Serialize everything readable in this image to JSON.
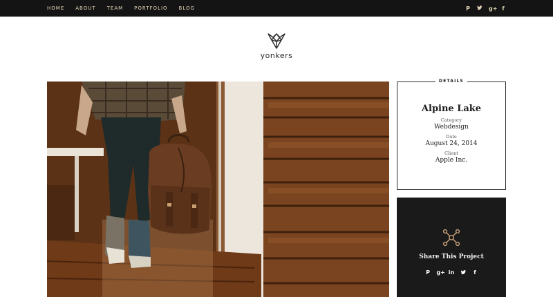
{
  "nav": {
    "items": [
      "HOME",
      "ABOUT",
      "TEAM",
      "PORTFOLIO",
      "BLOG"
    ]
  },
  "social_top": {
    "icons": [
      {
        "name": "pinterest-icon",
        "glyph": "P"
      },
      {
        "name": "twitter-icon",
        "glyph": "ᵛ"
      },
      {
        "name": "google-plus-icon",
        "glyph": "g+"
      },
      {
        "name": "facebook-icon",
        "glyph": "f"
      }
    ]
  },
  "brand": {
    "name": "yonkers"
  },
  "details": {
    "legend": "DETAILS",
    "title": "Alpine Lake",
    "category_label": "Category",
    "category_value": "Webdesign",
    "date_label": "Date",
    "date_value": "August 24, 2014",
    "client_label": "Client",
    "client_value": "Apple Inc."
  },
  "share": {
    "title": "Share This Project",
    "icons": [
      {
        "name": "pinterest-icon",
        "glyph": "P"
      },
      {
        "name": "google-plus-icon",
        "glyph": "g+"
      },
      {
        "name": "linkedin-icon",
        "glyph": "in"
      },
      {
        "name": "twitter-icon",
        "glyph": "t"
      },
      {
        "name": "facebook-icon",
        "glyph": "f"
      }
    ]
  },
  "colors": {
    "topbar": "#141414",
    "nav_text": "#e6d8b8",
    "accent": "#c9a27a",
    "share_bg": "#1a1a1a"
  }
}
